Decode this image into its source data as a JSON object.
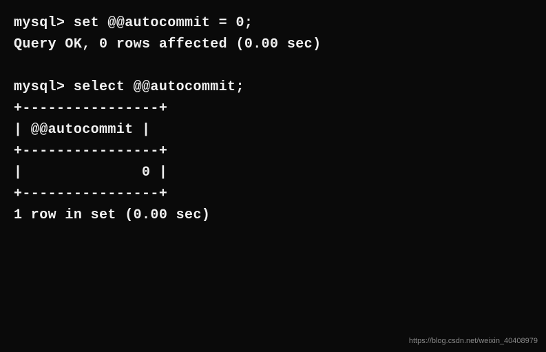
{
  "terminal": {
    "lines": [
      "mysql> set @@autocommit = 0;",
      "Query OK, 0 rows affected (0.00 sec)",
      "",
      "mysql> select @@autocommit;",
      "+----------------+",
      "| @@autocommit |",
      "+----------------+",
      "|              0 |",
      "+----------------+",
      "1 row in set (0.00 sec)"
    ]
  },
  "watermark": {
    "text": "https://blog.csdn.net/weixin_40408979"
  }
}
